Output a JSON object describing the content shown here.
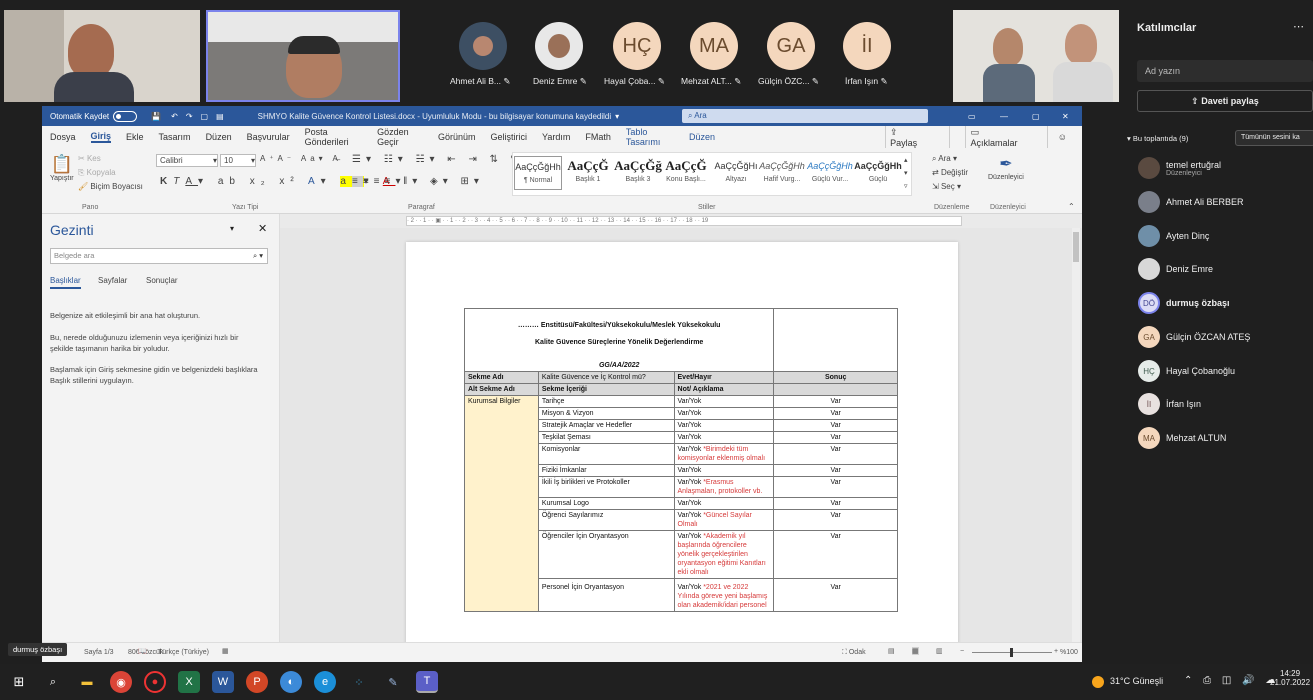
{
  "video": {
    "attendees": [
      {
        "initials": "",
        "name": "Ahmet Ali B..."
      },
      {
        "initials": "",
        "name": "Deniz Emre"
      },
      {
        "initials": "HÇ",
        "name": "Hayal Çoba..."
      },
      {
        "initials": "MA",
        "name": "Mehzat ALT..."
      },
      {
        "initials": "GA",
        "name": "Gülçin ÖZC..."
      },
      {
        "initials": "İI",
        "name": "İrfan Işın"
      }
    ],
    "self_label": "durmuş özbaşı"
  },
  "word": {
    "autosave_label": "Otomatik Kaydet",
    "title": "SHMYO Kalite Güvence Kontrol Listesi.docx  -  Uyumluluk Modu  -  bu bilgisayar konumuna kaydedildi",
    "search_placeholder": "Ara",
    "tabs": [
      "Dosya",
      "Giriş",
      "Ekle",
      "Tasarım",
      "Düzen",
      "Başvurular",
      "Posta Gönderileri",
      "Gözden Geçir",
      "Görünüm",
      "Geliştirici",
      "Yardım",
      "FMath",
      "Tablo Tasarımı",
      "Düzen"
    ],
    "share_label": "Paylaş",
    "comments_label": "Açıklamalar",
    "ribbon": {
      "paste": "Yapıştır",
      "cut": "Kes",
      "copy": "Kopyala",
      "format_painter": "Biçim Boyacısı",
      "clipboard_group": "Pano",
      "font_name": "Calibri",
      "font_size": "10",
      "font_group": "Yazı Tipi",
      "paragraph_group": "Paragraf",
      "styles_group": "Stiller",
      "styles": [
        {
          "sample": "AaÇçĞğHh",
          "name": "¶ Normal"
        },
        {
          "sample": "AaÇçĞ",
          "name": "Başlık 1"
        },
        {
          "sample": "AaÇçĞğ",
          "name": "Başlık 3"
        },
        {
          "sample": "AaÇçĞ",
          "name": "Konu Başlı..."
        },
        {
          "sample": "AaÇçĞğHı",
          "name": "Altyazı"
        },
        {
          "sample": "AaÇçĞğHh",
          "name": "Hafif Vurg..."
        },
        {
          "sample": "AaÇçĞğHh",
          "name": "Güçlü Vur..."
        },
        {
          "sample": "AaÇçĞğHh",
          "name": "Güçlü"
        }
      ],
      "find": "Ara",
      "replace": "Değiştir",
      "select": "Seç",
      "editing_group": "Düzenleme",
      "editor": "Düzenleyici",
      "editor_group": "Düzenleyici"
    },
    "nav": {
      "title": "Gezinti",
      "search_placeholder": "Belgede ara",
      "tabs": [
        "Başlıklar",
        "Sayfalar",
        "Sonuçlar"
      ],
      "help": [
        "Belgenize ait etkileşimli bir ana hat oluşturun.",
        "Bu, nerede olduğunuzu izlemenin veya içeriğinizi hızlı bir şekilde taşımanın harika bir yoludur.",
        "Başlamak için Giriş sekmesine gidin ve belgenizdeki başlıklara Başlık stillerini uygulayın."
      ]
    },
    "document": {
      "heading1": "……… Enstitüsü/Fakültesi/Yüksekokulu/Meslek Yüksekokulu",
      "heading2": "Kalite Güvence Süreçlerine Yönelik Değerlendirme",
      "date": "GG/AA/2022",
      "header_row1": [
        "Sekme Adı",
        "Kalite Güvence ve İç Kontrol mü?",
        "Evet/Hayır",
        "Sonuç"
      ],
      "header_row2": [
        "Alt Sekme Adı",
        "Sekme İçeriği",
        "Not/ Açıklama",
        ""
      ],
      "section": "Kurumsal Bilgiler",
      "rows": [
        {
          "item": "Tarihçe",
          "val": "Var/Yok",
          "note": "",
          "res": "Var"
        },
        {
          "item": "Misyon & Vizyon",
          "val": "Var/Yok",
          "note": "",
          "res": "Var"
        },
        {
          "item": "Stratejik Amaçlar ve Hedefler",
          "val": "Var/Yok",
          "note": "",
          "res": "Var"
        },
        {
          "item": "Teşkilat Şeması",
          "val": "Var/Yok",
          "note": "",
          "res": "Var"
        },
        {
          "item": "Komisyonlar",
          "val": "Var/Yok",
          "note": " *Birimdeki tüm komisyonlar eklenmiş olmalı",
          "res": "Var"
        },
        {
          "item": "Fiziki İmkanlar",
          "val": "Var/Yok",
          "note": "",
          "res": "Var"
        },
        {
          "item": "İkili İş birlikleri ve Protokoller",
          "val": "Var/Yok",
          "note": " *Erasmus Anlaşmaları, protokoller vb.",
          "res": "Var"
        },
        {
          "item": "Kurumsal Logo",
          "val": "Var/Yok",
          "note": "",
          "res": "Var"
        },
        {
          "item": "Öğrenci Sayılarımız",
          "val": "Var/Yok",
          "note": " *Güncel Sayılar Olmalı",
          "res": "Var"
        },
        {
          "item": "Öğrenciler İçin Oryantasyon",
          "val": "Var/Yok",
          "note": " *Akademik yıl başlarında öğrencilere yönelik gerçekleştirilen oryantasyon eğitimi Kanıtları ekli olmalı",
          "res": "Var"
        },
        {
          "item": "Personel İçin Oryantasyon",
          "val": "Var/Yok",
          "note": " *2021 ve 2022 Yılında göreve yeni başlamış olan akademik/idari personel",
          "res": "Var"
        }
      ]
    },
    "status": {
      "page": "Sayfa 1/3",
      "words": "806 sözcük",
      "language": "Türkçe (Türkiye)",
      "focus": "Odak",
      "zoom": "%100"
    }
  },
  "panel": {
    "title": "Katılımcılar",
    "search_placeholder": "Ad yazın",
    "invite_label": "Daveti paylaş",
    "section_label": "Bu toplantıda (9)",
    "mute_all_label": "Tümünün sesini ka",
    "participants": [
      {
        "initials": "",
        "name": "temel ertuğral",
        "role": "Düzenleyici"
      },
      {
        "initials": "",
        "name": "Ahmet Ali BERBER",
        "role": ""
      },
      {
        "initials": "",
        "name": "Ayten Dinç",
        "role": ""
      },
      {
        "initials": "",
        "name": "Deniz Emre",
        "role": ""
      },
      {
        "initials": "DÖ",
        "name": "durmuş özbaşı",
        "role": ""
      },
      {
        "initials": "GA",
        "name": "Gülçin ÖZCAN ATEŞ",
        "role": ""
      },
      {
        "initials": "HÇ",
        "name": "Hayal Çobanoğlu",
        "role": ""
      },
      {
        "initials": "İI",
        "name": "İrfan Işın",
        "role": ""
      },
      {
        "initials": "MA",
        "name": "Mehzat ALTUN",
        "role": ""
      }
    ]
  },
  "taskbar": {
    "weather": "31°C  Güneşli",
    "time": "14:29",
    "date": "21.07.2022"
  }
}
